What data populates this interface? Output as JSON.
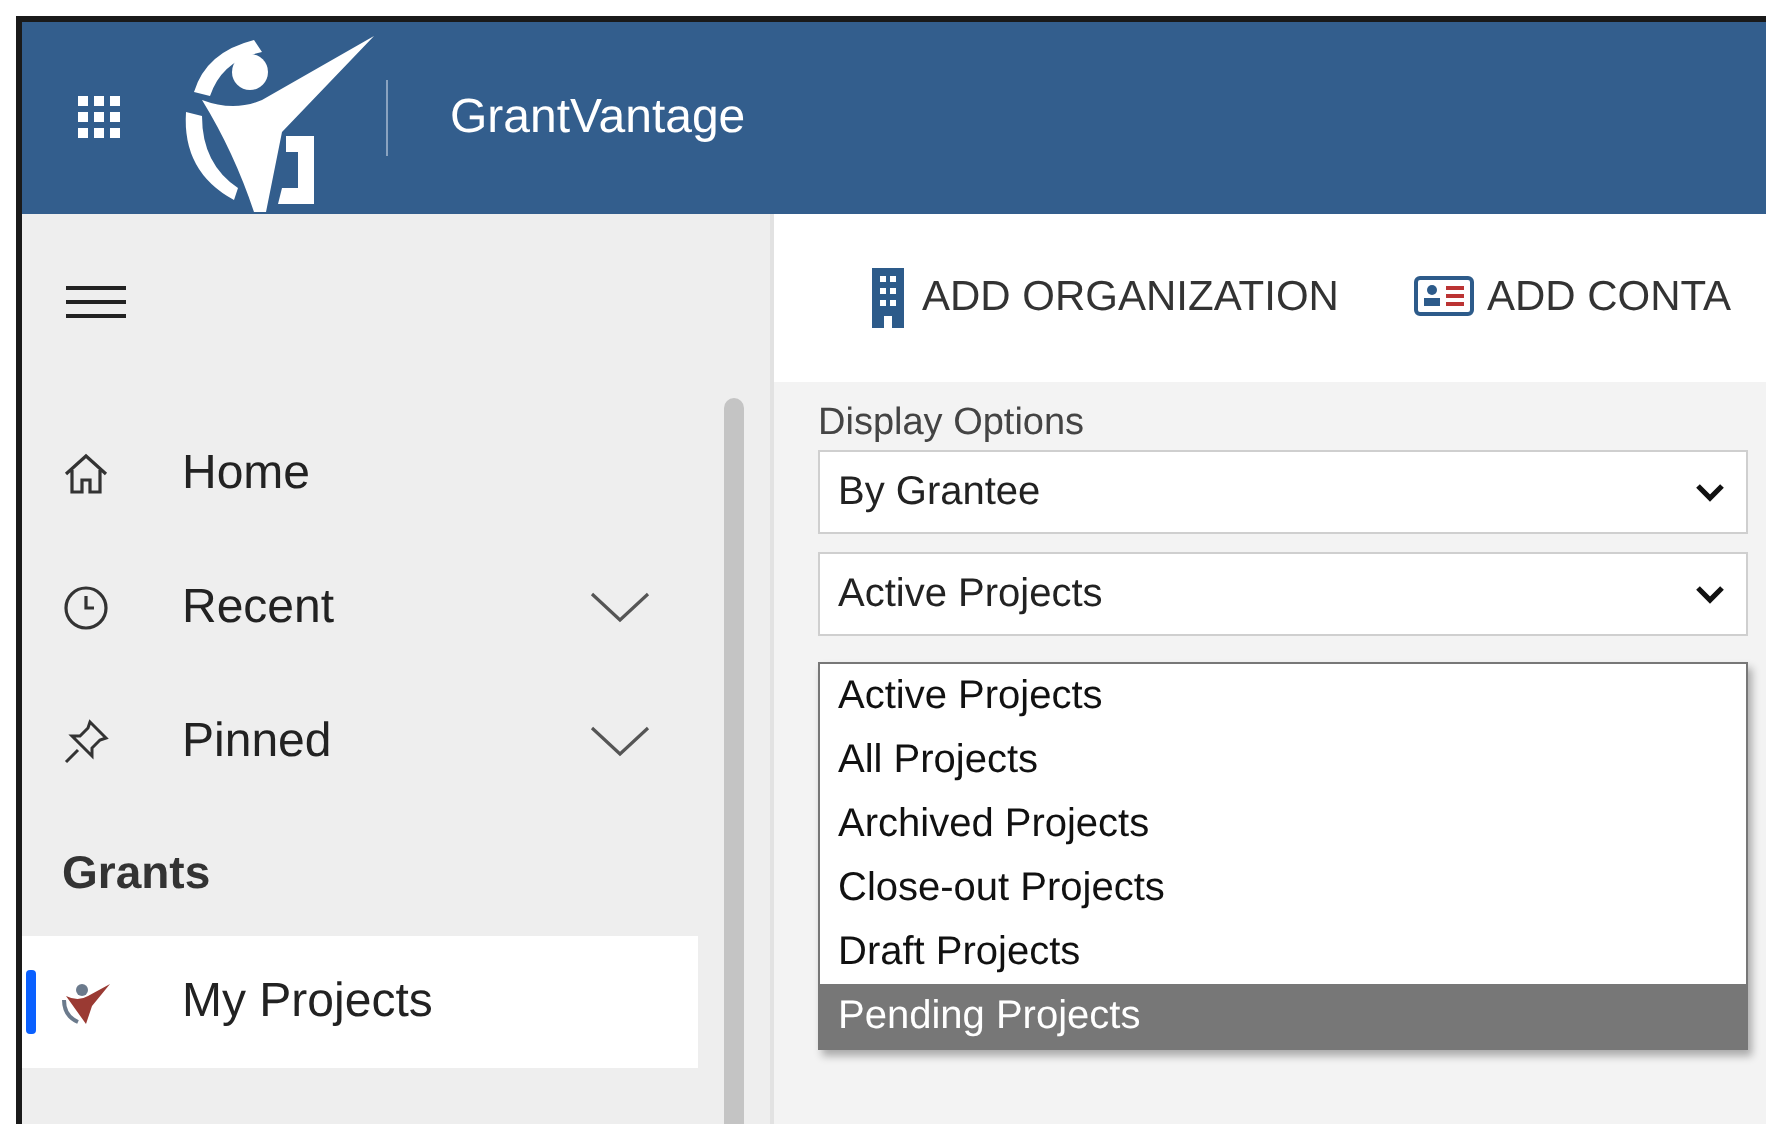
{
  "header": {
    "app_name": "GrantVantage"
  },
  "sidebar": {
    "items": [
      {
        "kind": "link",
        "label": "Home",
        "selected": false
      },
      {
        "kind": "expandable",
        "label": "Recent",
        "expanded": false,
        "selected": false
      },
      {
        "kind": "expandable",
        "label": "Pinned",
        "expanded": false,
        "selected": false
      },
      {
        "kind": "heading",
        "label": "Grants"
      },
      {
        "kind": "link",
        "label": "My Projects",
        "selected": true
      }
    ]
  },
  "toolbar": {
    "buttons": [
      "ADD ORGANIZATION",
      "ADD CONTA"
    ]
  },
  "display_options": {
    "label": "Display Options",
    "selects": [
      {
        "value": "By Grantee"
      },
      {
        "value": "Active Projects",
        "options": [
          {
            "label": "Active Projects",
            "highlighted": false
          },
          {
            "label": "All Projects",
            "highlighted": false
          },
          {
            "label": "Archived Projects",
            "highlighted": false
          },
          {
            "label": "Close-out Projects",
            "highlighted": false
          },
          {
            "label": "Draft Projects",
            "highlighted": false
          },
          {
            "label": "Pending Projects",
            "highlighted": true
          }
        ]
      }
    ]
  }
}
